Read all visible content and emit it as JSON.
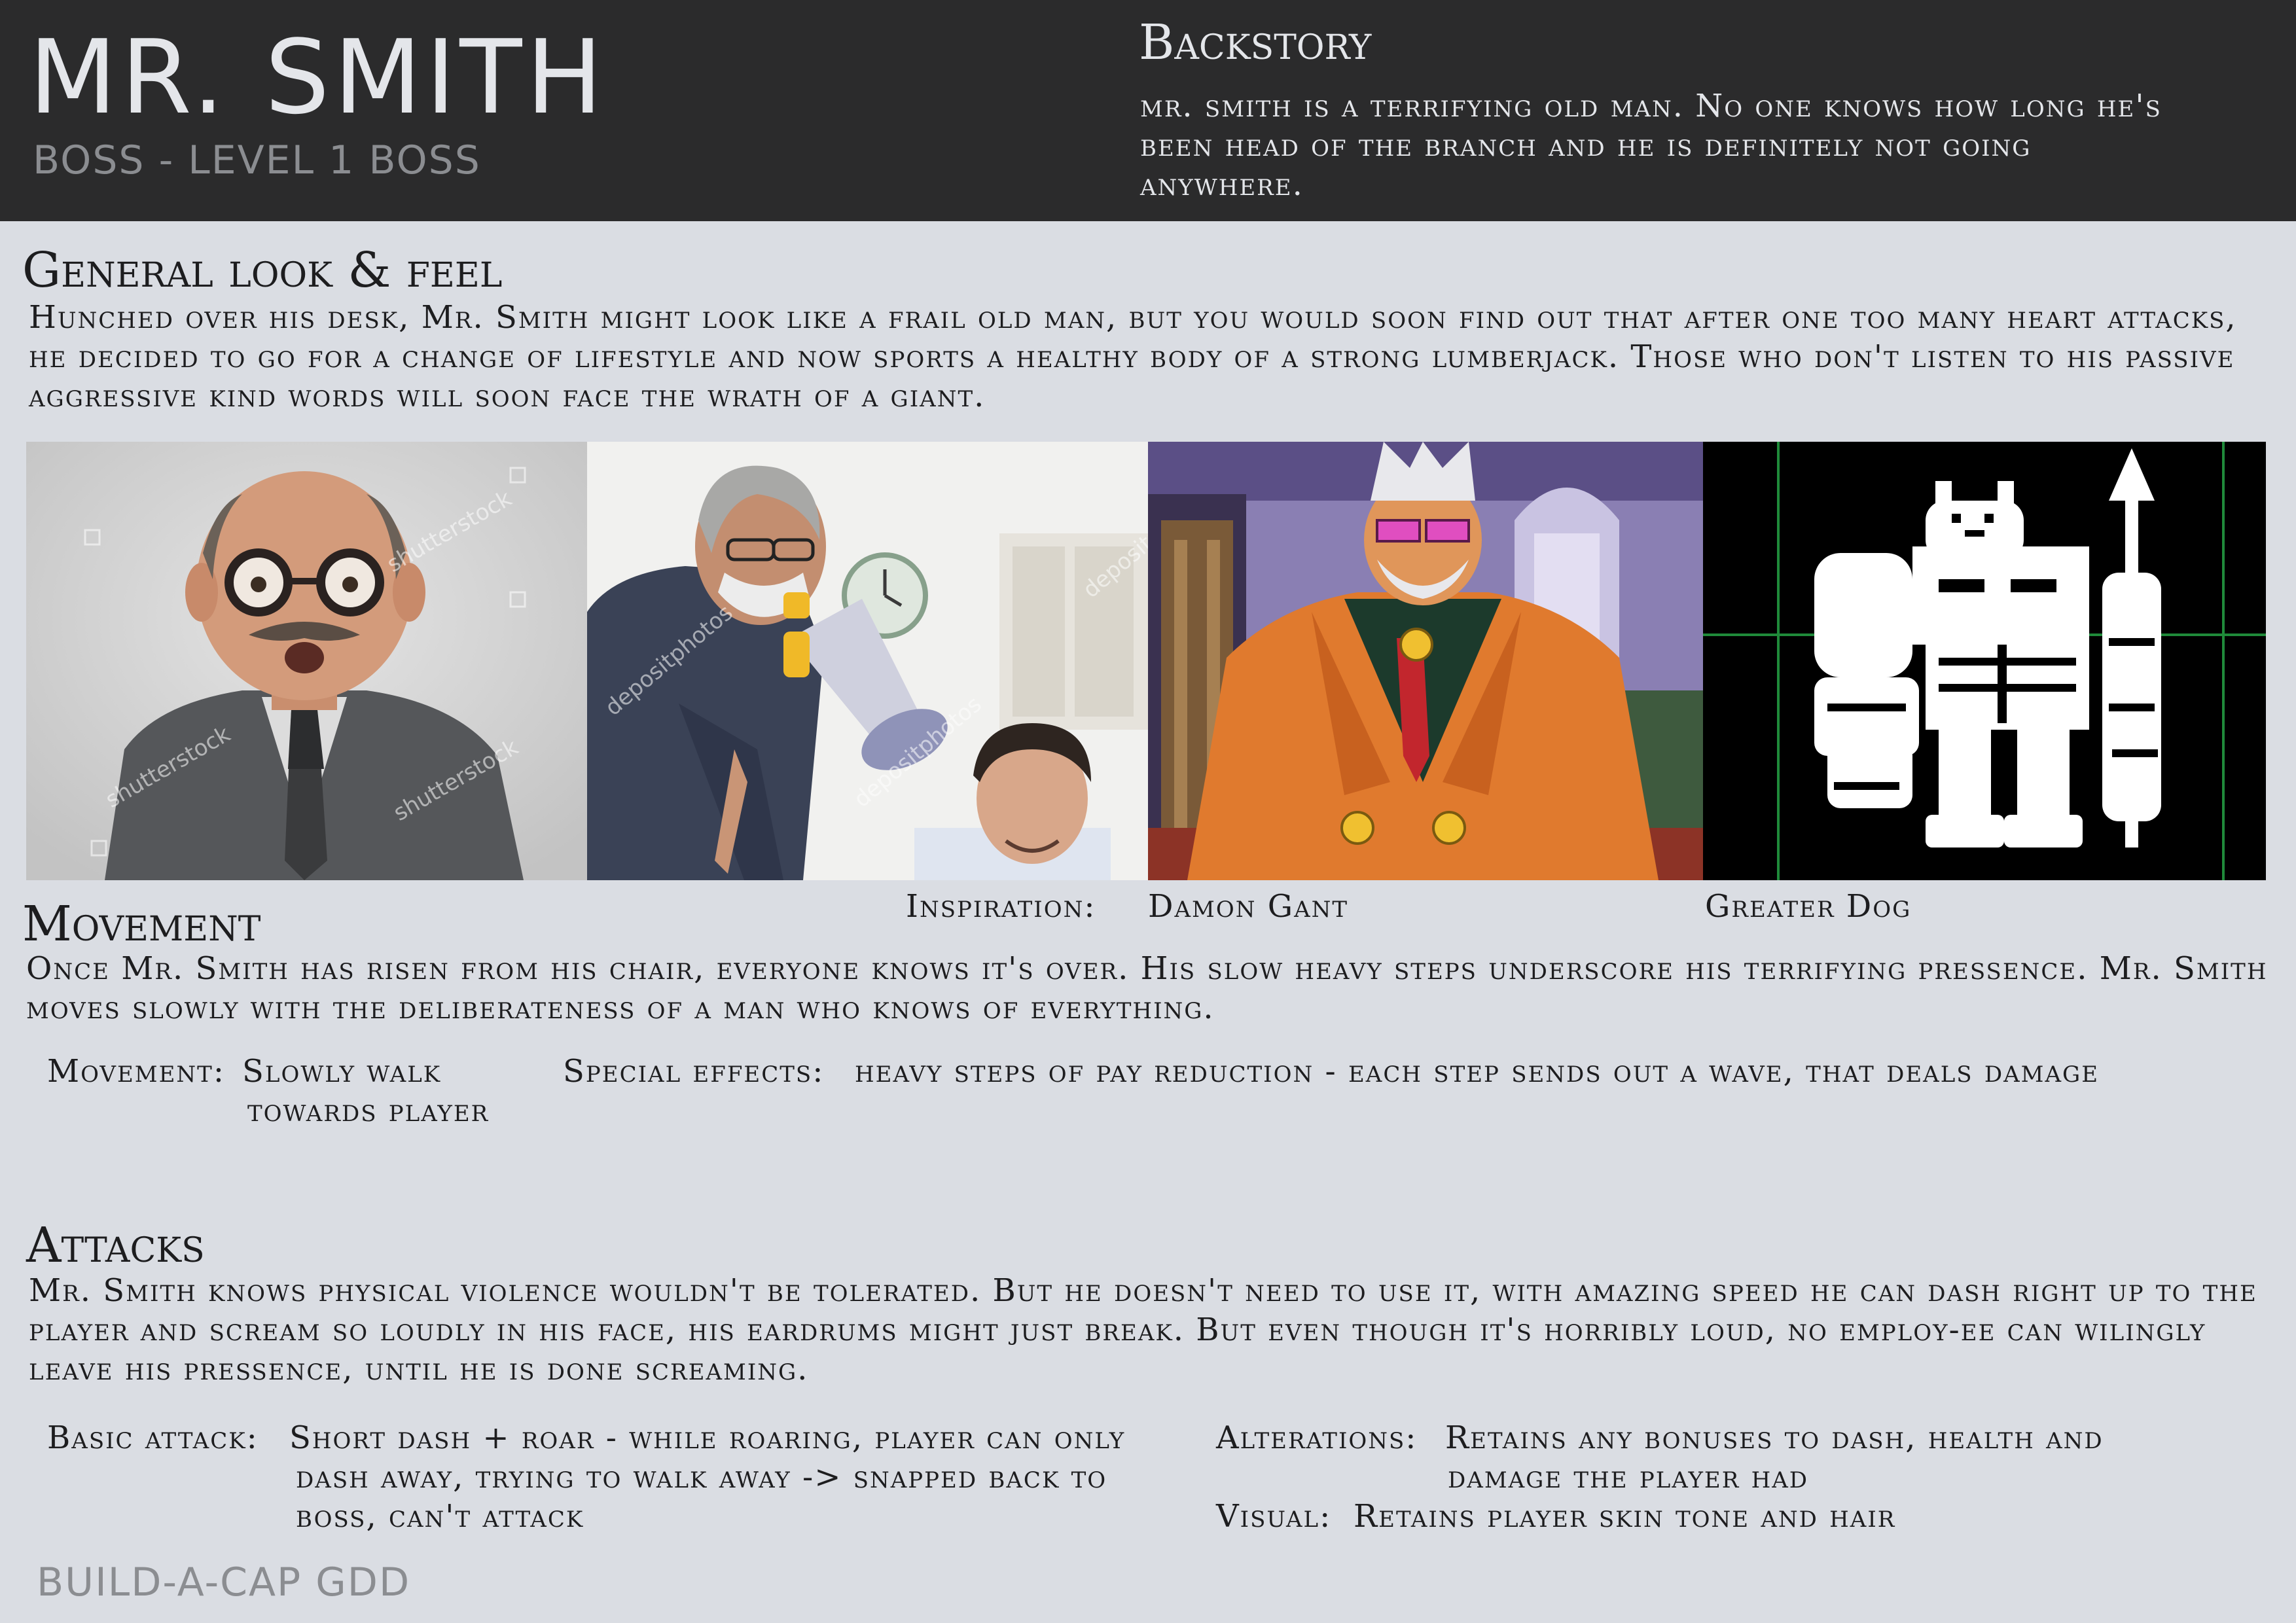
{
  "header": {
    "title": "MR. SMITH",
    "subtitle": "BOSS - LEVEL 1 BOSS"
  },
  "backstory": {
    "heading": "Backstory",
    "text": "mr. smith is a terrifying old man. No one knows how long he's been head of the branch and he is definitely not going anywhere."
  },
  "general": {
    "heading": "General look & feel",
    "text": "Hunched over his desk, Mr. Smith might look like a frail old man, but you would soon find out that after one too many heart attacks, he decided to go for a change of lifestyle and now sports a healthy body of a strong lumberjack. Those who don't listen to his passive aggressive kind words will soon face the wrath of a giant."
  },
  "images": [
    {
      "name": "Bald man with glasses and mustache photo",
      "watermark": "shutterstock"
    },
    {
      "name": "Boss shouting into megaphone photo",
      "watermark": "depositphotos"
    },
    {
      "name": "Damon Gant character art"
    },
    {
      "name": "Greater Dog pixel sprite"
    }
  ],
  "inspiration": {
    "label": "Inspiration:",
    "name1": "Damon Gant",
    "name2": "Greater Dog"
  },
  "movement": {
    "heading": "Movement",
    "text": "Once Mr. Smith has risen from his chair, everyone knows it's over. His slow heavy steps underscore his terrifying pressence. Mr. Smith moves slowly with the deliberateness of a man who knows of everything.",
    "label": "Movement:",
    "value_line1": "Slowly walk",
    "value_line2": "towards player",
    "special_label": "Special effects:",
    "special_value": "heavy steps of pay reduction - each step sends out a wave, that deals damage"
  },
  "attacks": {
    "heading": "Attacks",
    "text": "Mr. Smith knows physical violence wouldn't be tolerated. But he doesn't need to use it, with amazing speed he can dash right up to the player and scream so loudly in his face, his eardrums might just break. But even though it's horribly loud, no employ-ee can wilingly leave his pressence, until he is done screaming.",
    "basic_label": "Basic attack:",
    "basic_line1": "Short dash + roar - while roaring, player can only",
    "basic_line2": "dash away, trying to walk away -> snapped back to",
    "basic_line3": "boss, can't attack",
    "alt_label": "Alterations:",
    "alt_line1": "Retains any bonuses to dash, health and",
    "alt_line2": "damage the player had",
    "visual_label": "Visual:",
    "visual_value": "Retains player skin tone and hair"
  },
  "footer": "BUILD-A-CAP GDD"
}
